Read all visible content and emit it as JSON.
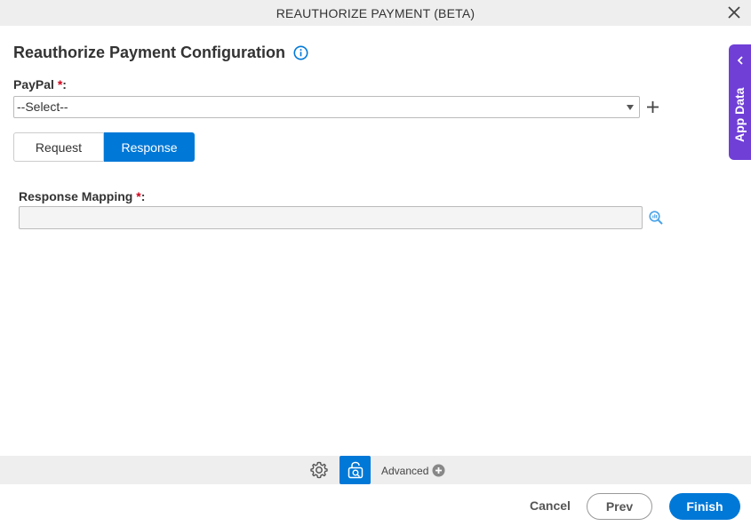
{
  "dialog": {
    "title": "REAUTHORIZE PAYMENT (BETA)"
  },
  "config": {
    "heading": "Reauthorize Payment Configuration",
    "paypal_label": "PayPal",
    "required_mark": "*",
    "label_suffix": ":",
    "paypal_select_value": "--Select--"
  },
  "tabs": [
    {
      "label": "Request",
      "active": false
    },
    {
      "label": "Response",
      "active": true
    }
  ],
  "response": {
    "mapping_label": "Response Mapping",
    "mapping_value": ""
  },
  "side_panel": {
    "label": "App Data"
  },
  "toolbar": {
    "advanced_label": "Advanced"
  },
  "footer": {
    "cancel_label": "Cancel",
    "prev_label": "Prev",
    "finish_label": "Finish"
  },
  "colors": {
    "primary": "#0078d7",
    "app_data": "#6f3fd6",
    "required": "#d0021b"
  },
  "icons": {
    "close": "close-icon",
    "info": "info-icon",
    "add": "plus-icon",
    "search": "search-icon",
    "settings": "gear-icon",
    "advanced": "plus-circle-icon"
  }
}
